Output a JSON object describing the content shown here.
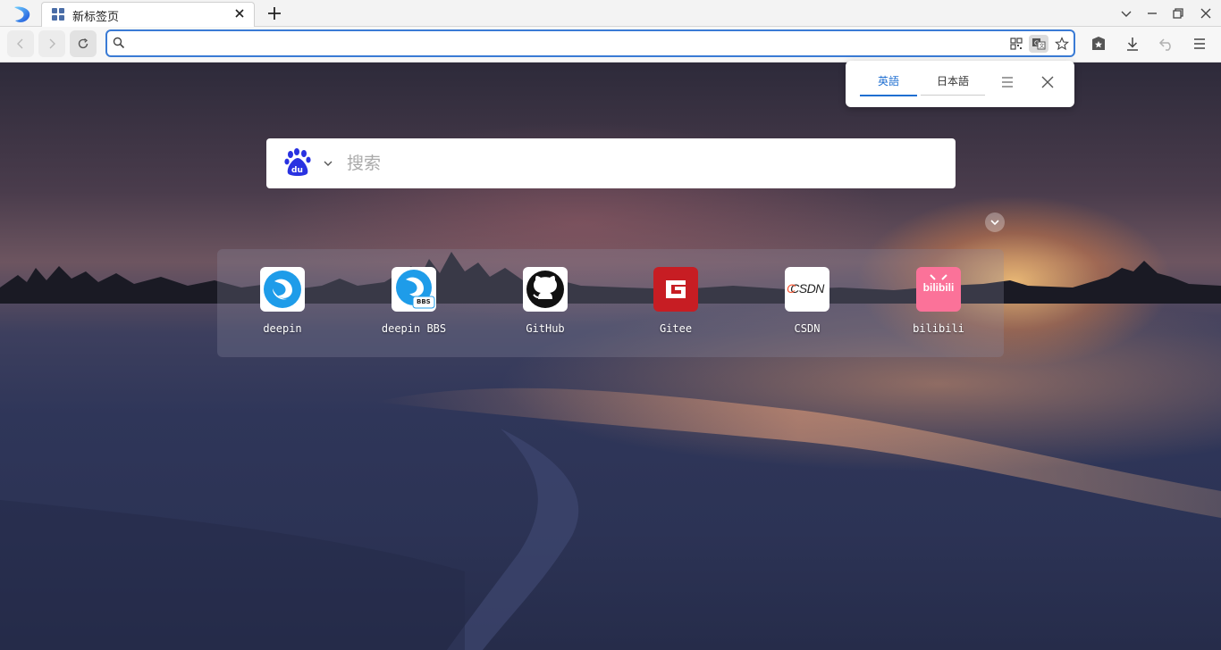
{
  "tab": {
    "title": "新标签页"
  },
  "address_bar": {
    "value": ""
  },
  "translate_popup": {
    "lang_a": "英語",
    "lang_b": "日本語"
  },
  "search": {
    "placeholder": "搜索",
    "engine": "baidu"
  },
  "speed_dial": [
    {
      "label": "deepin"
    },
    {
      "label": "deepin BBS",
      "badge": "BBS"
    },
    {
      "label": "GitHub"
    },
    {
      "label": "Gitee"
    },
    {
      "label": "CSDN",
      "logo_text": "CSDN"
    },
    {
      "label": "bilibili",
      "logo_text": "bilibili"
    }
  ],
  "colors": {
    "accent": "#3a7bd5",
    "gitee": "#c71d23",
    "csdn": "#fc5531",
    "bilibili": "#fb7299"
  }
}
